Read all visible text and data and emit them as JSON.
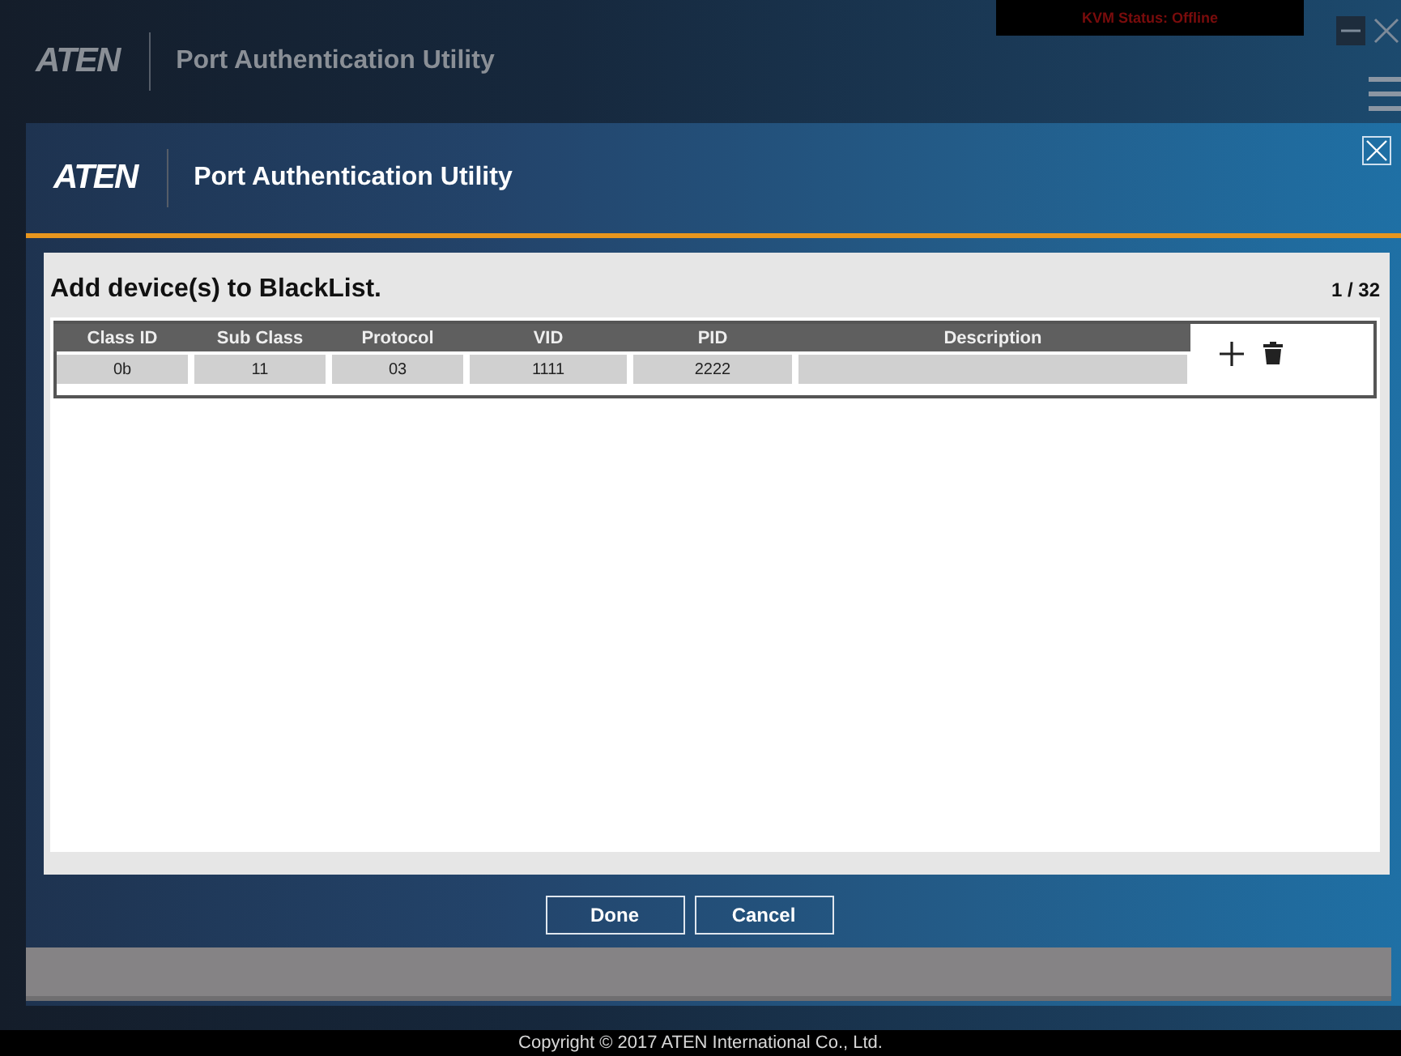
{
  "app": {
    "logo": "ATEN",
    "title": "Port Authentication Utility",
    "kvm_status": "KVM Status: Offline"
  },
  "dialog": {
    "logo": "ATEN",
    "title": "Port Authentication Utility",
    "heading": "Add device(s) to BlackList.",
    "count": "1 / 32",
    "table": {
      "columns": [
        "Class ID",
        "Sub Class",
        "Protocol",
        "VID",
        "PID",
        "Description"
      ],
      "rows": [
        [
          "0b",
          "11",
          "03",
          "1111",
          "2222",
          ""
        ]
      ]
    },
    "buttons": [
      "Done",
      "Cancel"
    ]
  },
  "footer": {
    "copyright": "Copyright © 2017 ATEN International Co., Ltd."
  }
}
